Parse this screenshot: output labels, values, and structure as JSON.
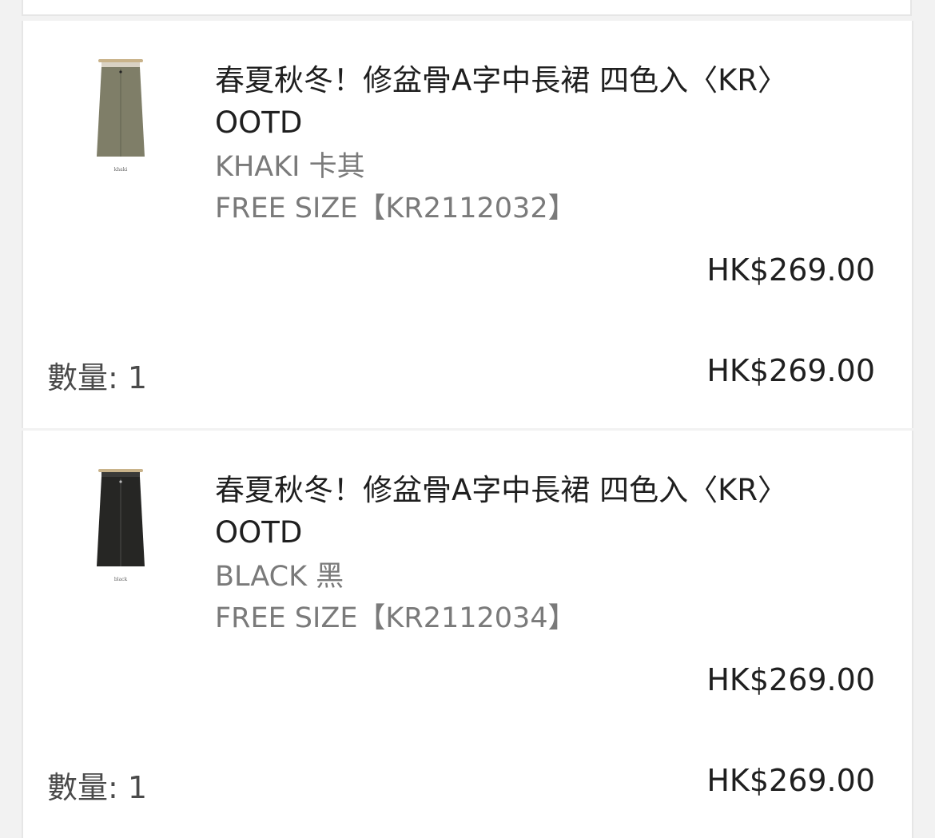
{
  "items": [
    {
      "title": "春夏秋冬！修盆骨A字中長裙 四色入〈KR〉OOTD",
      "variant": "KHAKI 卡其",
      "sku": "FREE SIZE【KR2112032】",
      "unit_price": "HK$269.00",
      "quantity_label": "數量: 1",
      "line_total": "HK$269.00",
      "thumb_label": "khaki",
      "skirt_color": "#7f7e68"
    },
    {
      "title": "春夏秋冬！修盆骨A字中長裙 四色入〈KR〉OOTD",
      "variant": "BLACK 黑",
      "sku": "FREE SIZE【KR2112034】",
      "unit_price": "HK$269.00",
      "quantity_label": "數量: 1",
      "line_total": "HK$269.00",
      "thumb_label": "black",
      "skirt_color": "#262624"
    }
  ]
}
